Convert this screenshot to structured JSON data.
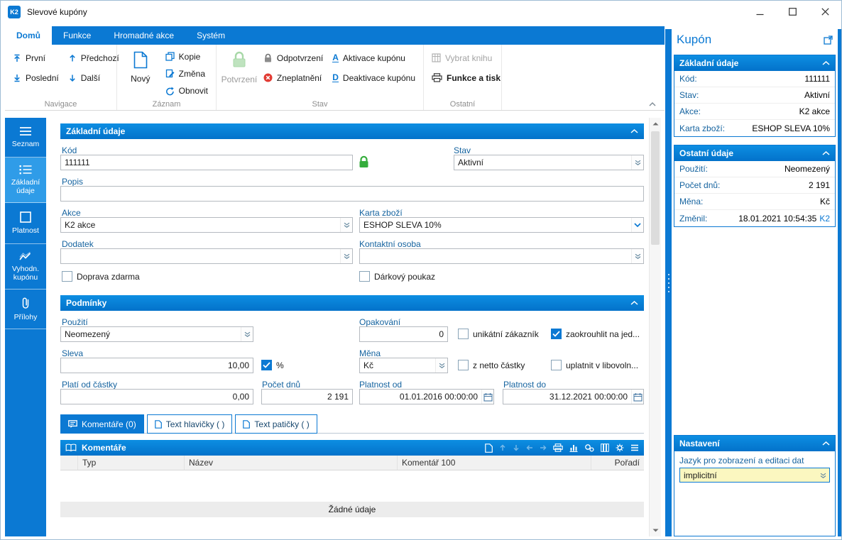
{
  "titlebar": {
    "logo": "K2",
    "title": "Slevové kupóny"
  },
  "ribbon": {
    "tabs": [
      {
        "label": "Domů"
      },
      {
        "label": "Funkce"
      },
      {
        "label": "Hromadné akce"
      },
      {
        "label": "Systém"
      }
    ],
    "nav": {
      "prvni": "První",
      "posledni": "Poslední",
      "predchozi": "Předchozí",
      "dalsi": "Další"
    },
    "zaznam": {
      "novy": "Nový",
      "kopie": "Kopie",
      "zmena": "Změna",
      "obnovit": "Obnovit"
    },
    "stav": {
      "potvrzeni": "Potvrzení",
      "odpotvrzeni": "Odpotvrzení",
      "zneplatneni": "Zneplatnění",
      "aktivace": "Aktivace kupónu",
      "deaktivace": "Deaktivace kupónu",
      "aktivace_icon": "A",
      "deaktivace_icon": "D"
    },
    "ostatni": {
      "vybrat": "Vybrat knihu",
      "funkce": "Funkce a tisk"
    },
    "group_labels": {
      "navigace": "Navigace",
      "zaznam": "Záznam",
      "stav": "Stav",
      "ostatni": "Ostatní"
    }
  },
  "sidebar": {
    "items": [
      {
        "label": "Seznam"
      },
      {
        "label": "Základní údaje"
      },
      {
        "label": "Platnost"
      },
      {
        "label": "Vyhodn. kupónu"
      },
      {
        "label": "Přílohy"
      }
    ]
  },
  "form": {
    "section1_title": "Základní údaje",
    "kod_label": "Kód",
    "kod_value": "111111",
    "stav_label": "Stav",
    "stav_value": "Aktivní",
    "popis_label": "Popis",
    "popis_value": "",
    "akce_label": "Akce",
    "akce_value": "K2 akce",
    "karta_label": "Karta zboží",
    "karta_value": "ESHOP SLEVA 10%",
    "dodatek_label": "Dodatek",
    "dodatek_value": "",
    "kontakt_label": "Kontaktní osoba",
    "kontakt_value": "",
    "doprava_label": "Doprava zdarma",
    "darkovy_label": "Dárkový poukaz",
    "section2_title": "Podmínky",
    "pouziti_label": "Použití",
    "pouziti_value": "Neomezený",
    "opakovani_label": "Opakování",
    "opakovani_value": "0",
    "unikatni_label": "unikátní zákazník",
    "zaokrouhlit_label": "zaokrouhlit na jed...",
    "sleva_label": "Sleva",
    "sleva_value": "10,00",
    "procento_label": "%",
    "mena_label": "Měna",
    "mena_value": "Kč",
    "znetto_label": "z netto částky",
    "uplatnit_label": "uplatnit v libovoln...",
    "plati_label": "Platí od částky",
    "plati_value": "0,00",
    "pocet_label": "Počet dnů",
    "pocet_value": "2 191",
    "platnost_od_label": "Platnost od",
    "platnost_od_value": "01.01.2016 00:00:00",
    "platnost_do_label": "Platnost do",
    "platnost_do_value": "31.12.2021 00:00:00"
  },
  "tabs": {
    "komentare": "Komentáře (0)",
    "hlavicka": "Text hlavičky ( )",
    "paticka": "Text patičky ( )"
  },
  "grid": {
    "title": "Komentáře",
    "columns": [
      "Typ",
      "Název",
      "Komentář 100",
      "Pořadí"
    ],
    "empty": "Žádné údaje"
  },
  "inspector": {
    "title": "Kupón",
    "s1_title": "Základní údaje",
    "s1_rows": [
      {
        "label": "Kód:",
        "value": "111111"
      },
      {
        "label": "Stav:",
        "value": "Aktivní"
      },
      {
        "label": "Akce:",
        "value": "K2 akce"
      },
      {
        "label": "Karta zboží:",
        "value": "ESHOP SLEVA 10%"
      }
    ],
    "s2_title": "Ostatní údaje",
    "s2_rows": [
      {
        "label": "Použití:",
        "value": "Neomezený"
      },
      {
        "label": "Počet dnů:",
        "value": "2 191"
      },
      {
        "label": "Měna:",
        "value": "Kč"
      },
      {
        "label": "Změnil:",
        "value": "18.01.2021 10:54:35",
        "suffix": "K2"
      }
    ],
    "s3_title": "Nastavení",
    "jazyk_label": "Jazyk pro zobrazení a editaci dat",
    "jazyk_value": "implicitní"
  },
  "colors": {
    "primary": "#0b79d3",
    "selected_item": "#2f9ce8",
    "label_blue": "#15639f",
    "green_lock": "#35ad3c",
    "red_invalid": "#e23b33",
    "focused_field": "#fbf7c0"
  }
}
